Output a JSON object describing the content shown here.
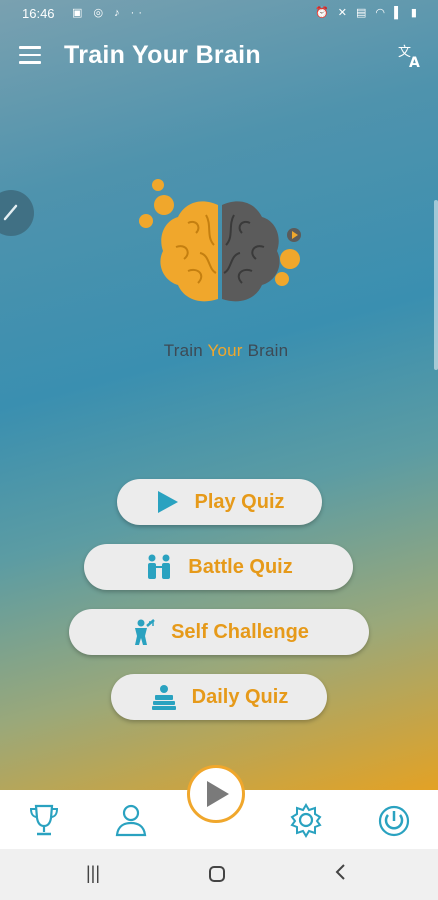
{
  "status_bar": {
    "time": "16:46",
    "left_icons": [
      "gallery-icon",
      "instagram-icon",
      "tiktok-icon",
      "more-dots-icon"
    ],
    "right_icons": [
      "alarm-icon",
      "mute-icon",
      "volte-icon",
      "wifi-icon",
      "signal-icon",
      "battery-icon"
    ]
  },
  "app_bar": {
    "title": "Train Your Brain",
    "menu_icon": "hamburger-menu-icon",
    "translate_icon": "translate-icon"
  },
  "logo": {
    "brand_part1": "Train",
    "brand_part2": " Your ",
    "brand_part3": "Brain"
  },
  "menu": {
    "play_quiz": "Play Quiz",
    "battle_quiz": "Battle Quiz",
    "self_challenge": "Self Challenge",
    "daily_quiz": "Daily Quiz"
  },
  "bottom_nav": {
    "items": [
      "leaderboard-trophy-icon",
      "profile-icon",
      "play-icon",
      "settings-icon",
      "power-icon"
    ]
  },
  "colors": {
    "accent": "#f0a72c",
    "teal": "#2aa2c0",
    "button_bg": "#ececec"
  }
}
